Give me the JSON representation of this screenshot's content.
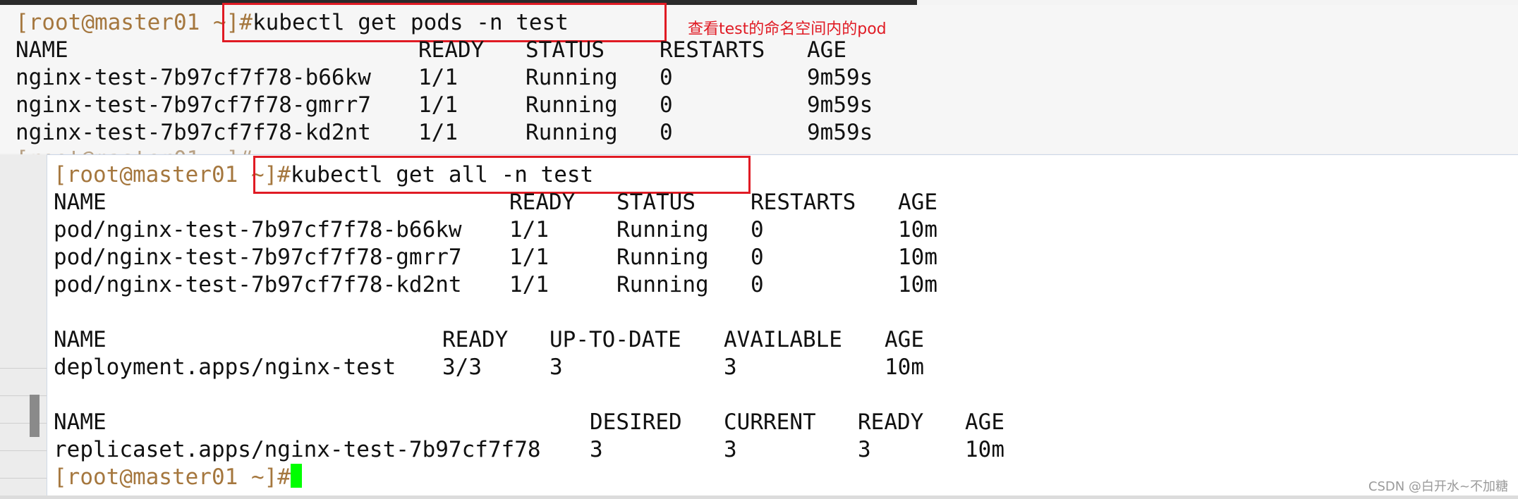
{
  "terminal1": {
    "prompt": "[root@master01 ~]#",
    "command": "kubectl get pods -n test",
    "annotation": "查看test的命名空间内的pod",
    "header": [
      "NAME",
      "READY",
      "STATUS",
      "RESTARTS",
      "AGE"
    ],
    "rows": [
      [
        "nginx-test-7b97cf7f78-b66kw",
        "1/1",
        "Running",
        "0",
        "9m59s"
      ],
      [
        "nginx-test-7b97cf7f78-gmrr7",
        "1/1",
        "Running",
        "0",
        "9m59s"
      ],
      [
        "nginx-test-7b97cf7f78-kd2nt",
        "1/1",
        "Running",
        "0",
        "9m59s"
      ]
    ],
    "ghost_prompt": "[root@master01 ~]#"
  },
  "terminal2": {
    "prompt": "[root@master01 ~]#",
    "command": "kubectl get all -n test",
    "pods": {
      "header": [
        "NAME",
        "READY",
        "STATUS",
        "RESTARTS",
        "AGE"
      ],
      "rows": [
        [
          "pod/nginx-test-7b97cf7f78-b66kw",
          "1/1",
          "Running",
          "0",
          "10m"
        ],
        [
          "pod/nginx-test-7b97cf7f78-gmrr7",
          "1/1",
          "Running",
          "0",
          "10m"
        ],
        [
          "pod/nginx-test-7b97cf7f78-kd2nt",
          "1/1",
          "Running",
          "0",
          "10m"
        ]
      ]
    },
    "deployments": {
      "header": [
        "NAME",
        "READY",
        "UP-TO-DATE",
        "AVAILABLE",
        "AGE"
      ],
      "rows": [
        [
          "deployment.apps/nginx-test",
          "3/3",
          "3",
          "3",
          "10m"
        ]
      ]
    },
    "replicasets": {
      "header": [
        "NAME",
        "DESIRED",
        "CURRENT",
        "READY",
        "AGE"
      ],
      "rows": [
        [
          "replicaset.apps/nginx-test-7b97cf7f78",
          "3",
          "3",
          "3",
          "10m"
        ]
      ]
    },
    "final_prompt": "[root@master01 ~]#"
  },
  "watermark": "CSDN @白开水~不加糖",
  "colors": {
    "prompt": "#a5773e",
    "highlight_box": "#e01b24",
    "cursor": "#00ff00"
  }
}
